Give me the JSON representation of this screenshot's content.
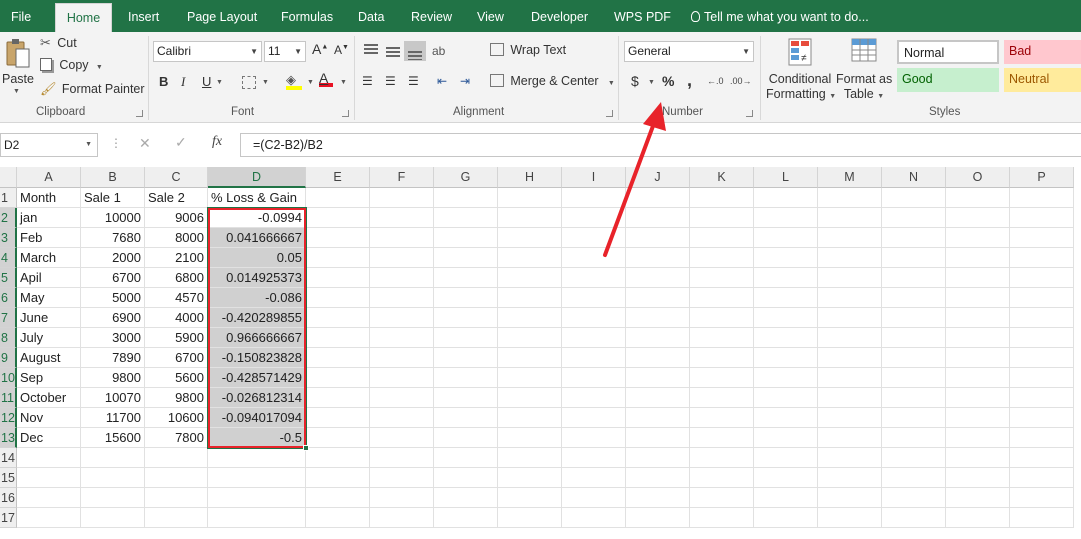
{
  "tabs": [
    "File",
    "Home",
    "Insert",
    "Page Layout",
    "Formulas",
    "Data",
    "Review",
    "View",
    "Developer",
    "WPS PDF"
  ],
  "tell_me": "Tell me what you want to do...",
  "clipboard": {
    "paste": "Paste",
    "cut": "Cut",
    "copy": "Copy",
    "format_painter": "Format Painter",
    "label": "Clipboard"
  },
  "font": {
    "name": "Calibri",
    "size": "11",
    "label": "Font",
    "bold": "B",
    "italic": "I",
    "underline": "U"
  },
  "alignment": {
    "wrap_text": "Wrap Text",
    "merge_center": "Merge & Center",
    "label": "Alignment"
  },
  "number": {
    "format": "General",
    "label": "Number",
    "currency": "$",
    "percent": "%",
    "comma": ","
  },
  "styles_group": {
    "conditional_formatting": [
      "Conditional",
      "Formatting"
    ],
    "format_as_table": [
      "Format as",
      "Table"
    ],
    "normal": "Normal",
    "bad": "Bad",
    "good": "Good",
    "neutral": "Neutral",
    "label": "Styles"
  },
  "formula_bar": {
    "name_box": "D2",
    "fx": "fx",
    "formula": "=(C2-B2)/B2"
  },
  "columns": [
    "A",
    "B",
    "C",
    "D",
    "E",
    "F",
    "G",
    "H",
    "I",
    "J",
    "K",
    "L",
    "M",
    "N",
    "O",
    "P"
  ],
  "rows": [
    "1",
    "2",
    "3",
    "4",
    "5",
    "6",
    "7",
    "8",
    "9",
    "10",
    "11",
    "12",
    "13",
    "14",
    "15",
    "16",
    "17"
  ],
  "headers": [
    "Month",
    "Sale 1",
    "Sale 2",
    "% Loss & Gain"
  ],
  "table": [
    [
      "jan",
      "10000",
      "9006",
      "-0.0994"
    ],
    [
      "Feb",
      "7680",
      "8000",
      "0.041666667"
    ],
    [
      "March",
      "2000",
      "2100",
      "0.05"
    ],
    [
      "Apil",
      "6700",
      "6800",
      "0.014925373"
    ],
    [
      "May",
      "5000",
      "4570",
      "-0.086"
    ],
    [
      "June",
      "6900",
      "4000",
      "-0.420289855"
    ],
    [
      "July",
      "3000",
      "5900",
      "0.966666667"
    ],
    [
      "August",
      "7890",
      "6700",
      "-0.150823828"
    ],
    [
      "Sep",
      "9800",
      "5600",
      "-0.428571429"
    ],
    [
      "October",
      "10070",
      "9800",
      "-0.026812314"
    ],
    [
      "Nov",
      "11700",
      "10600",
      "-0.094017094"
    ],
    [
      "Dec",
      "15600",
      "7800",
      "-0.5"
    ]
  ],
  "colors": {
    "excel_green": "#217346",
    "annotation_red": "#e8232a",
    "bad_fill": "#ffc7ce",
    "good_fill": "#c6efce",
    "neutral_fill": "#ffeb9c"
  }
}
